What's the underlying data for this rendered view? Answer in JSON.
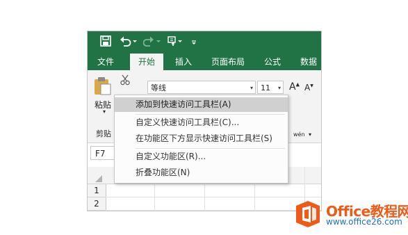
{
  "qat": {
    "save_icon": "save-icon",
    "undo_icon": "undo-icon",
    "redo_icon": "redo-icon",
    "touch_mode_icon": "touch-mode-icon",
    "customize_icon": "customize-qat-icon"
  },
  "tabs": [
    {
      "label": "文件"
    },
    {
      "label": "开始",
      "active": true
    },
    {
      "label": "插入"
    },
    {
      "label": "页面布局"
    },
    {
      "label": "公式"
    },
    {
      "label": "数据"
    }
  ],
  "ribbon": {
    "paste_label": "粘贴",
    "clipboard_group_label": "剪贴",
    "font_name": "等线",
    "font_size": "11",
    "phonetic_label": "wén"
  },
  "namebox": {
    "value": "F7"
  },
  "rows": [
    "1",
    "2"
  ],
  "context_menu": {
    "items": [
      {
        "label": "添加到快速访问工具栏(A)",
        "highlighted": true
      },
      {
        "label": "自定义快速访问工具栏(C)..."
      },
      {
        "label": "在功能区下方显示快速访问工具栏(S)"
      },
      {
        "label": "自定义功能区(R)..."
      },
      {
        "label": "折叠功能区(N)"
      }
    ]
  },
  "watermark": {
    "title": "Office教程网",
    "url": "www.office26.com",
    "brand_color": "#ee5a18",
    "url_color": "#1e6fbf"
  },
  "colors": {
    "excel_green": "#217346",
    "ribbon_bg": "#f3f3f3"
  }
}
